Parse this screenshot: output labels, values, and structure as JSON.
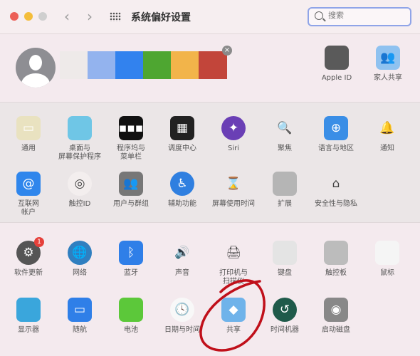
{
  "window": {
    "title": "系统偏好设置",
    "back": "‹",
    "forward": "›"
  },
  "search": {
    "placeholder": "搜索"
  },
  "account": {
    "swatches": [
      "#eeeae9",
      "#93b3ee",
      "#3282ee",
      "#4ea631",
      "#f2b44a",
      "#c2453a"
    ],
    "close": "×",
    "items": [
      {
        "label": "Apple ID",
        "icon": "apple-icon",
        "color": "#5a5a5a",
        "glyph": ""
      },
      {
        "label": "家人共享",
        "icon": "family-icon",
        "color": "#8fc2f0",
        "glyph": "👥"
      }
    ]
  },
  "rows": [
    [
      {
        "label": "通用",
        "icon": "general-icon",
        "color": "#e9e2c0",
        "glyph": "▭"
      },
      {
        "label": "桌面与\n屏幕保护程序",
        "icon": "desktop-icon",
        "color": "#6fc6e6",
        "glyph": ""
      },
      {
        "label": "程序坞与\n菜单栏",
        "icon": "dock-icon",
        "color": "#111",
        "glyph": "▪▪▪"
      },
      {
        "label": "调度中心",
        "icon": "mission-control-icon",
        "color": "#222",
        "glyph": "▦"
      },
      {
        "label": "Siri",
        "icon": "siri-icon",
        "color": "#6a3fb5",
        "glyph": "✦",
        "round": true
      },
      {
        "label": "聚焦",
        "icon": "spotlight-icon",
        "color": "transparent",
        "glyph": "🔍"
      },
      {
        "label": "语言与地区",
        "icon": "language-flag-icon",
        "color": "#3a8ee6",
        "glyph": "⊕"
      },
      {
        "label": "通知",
        "icon": "bell-icon",
        "color": "transparent",
        "glyph": "🔔",
        "dark": true
      }
    ],
    [
      {
        "label": "互联网\n帐户",
        "icon": "at-icon",
        "color": "#2f86ec",
        "glyph": "@"
      },
      {
        "label": "触控ID",
        "icon": "fingerprint-icon",
        "color": "#f3eeee",
        "glyph": "◎",
        "dark": true,
        "round": true
      },
      {
        "label": "用户与群组",
        "icon": "users-icon",
        "color": "#777",
        "glyph": "👥"
      },
      {
        "label": "辅助功能",
        "icon": "accessibility-icon",
        "color": "#2f7fe0",
        "glyph": "♿",
        "round": true
      },
      {
        "label": "屏幕使用时间",
        "icon": "hourglass-icon",
        "color": "transparent",
        "glyph": "⌛",
        "dark": true
      },
      {
        "label": "扩展",
        "icon": "puzzle-icon",
        "color": "#b5b5b5",
        "glyph": ""
      },
      {
        "label": "安全性与隐私",
        "icon": "house-lock-icon",
        "color": "transparent",
        "glyph": "⌂",
        "dark": true
      }
    ],
    [
      {
        "label": "软件更新",
        "icon": "gear-icon",
        "color": "#555",
        "glyph": "⚙",
        "round": true,
        "badge": "1"
      },
      {
        "label": "网络",
        "icon": "globe-icon",
        "color": "#2f7fc0",
        "glyph": "🌐",
        "round": true
      },
      {
        "label": "蓝牙",
        "icon": "bluetooth-icon",
        "color": "#2f7fe8",
        "glyph": "ᛒ"
      },
      {
        "label": "声音",
        "icon": "speaker-icon",
        "color": "transparent",
        "glyph": "🔊",
        "dark": true
      },
      {
        "label": "打印机与\n扫描仪",
        "icon": "printer-icon",
        "color": "transparent",
        "glyph": "🖨",
        "dark": true
      },
      {
        "label": "键盘",
        "icon": "keyboard-icon",
        "color": "#e4e4e4",
        "glyph": ""
      },
      {
        "label": "触控板",
        "icon": "trackpad-icon",
        "color": "#bcbcbc",
        "glyph": ""
      },
      {
        "label": "鼠标",
        "icon": "mouse-icon",
        "color": "#f5f5f5",
        "glyph": ""
      }
    ],
    [
      {
        "label": "显示器",
        "icon": "display-icon",
        "color": "#3aa6dc",
        "glyph": ""
      },
      {
        "label": "随航",
        "icon": "sidecar-icon",
        "color": "#2f7fe8",
        "glyph": "▭"
      },
      {
        "label": "电池",
        "icon": "battery-icon",
        "color": "#5cc83a",
        "glyph": ""
      },
      {
        "label": "日期与时间",
        "icon": "clock-icon",
        "color": "#f8f8f8",
        "glyph": "🕓",
        "dark": true,
        "round": true
      },
      {
        "label": "共享",
        "icon": "sharing-folder-icon",
        "color": "#6fb3ea",
        "glyph": "◆"
      },
      {
        "label": "时间机器",
        "icon": "time-machine-icon",
        "color": "#1f5a4a",
        "glyph": "↺",
        "round": true
      },
      {
        "label": "启动磁盘",
        "icon": "disk-icon",
        "color": "#888",
        "glyph": "◉"
      }
    ]
  ],
  "annotation": {
    "color": "#c0101a"
  }
}
